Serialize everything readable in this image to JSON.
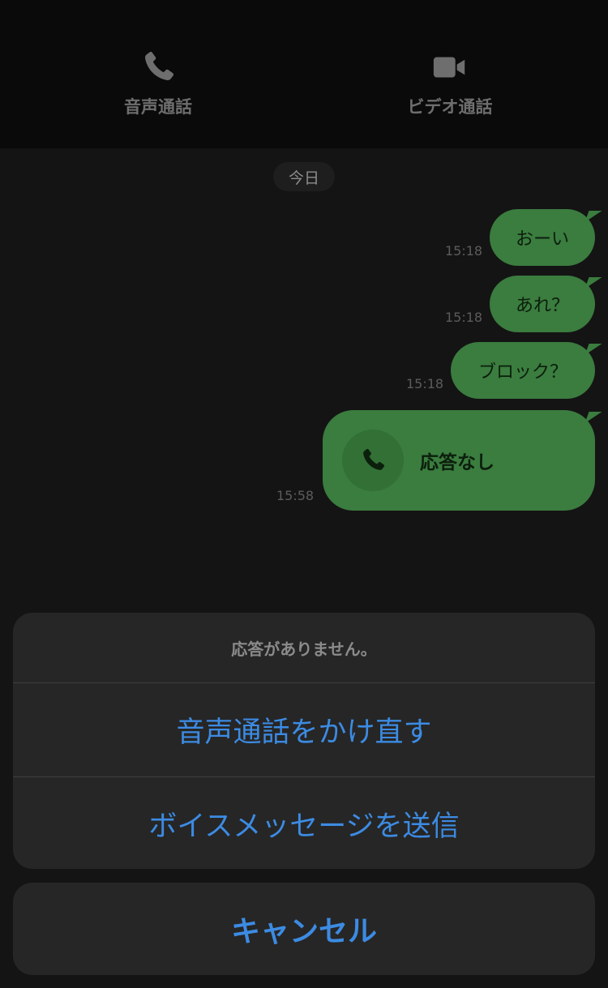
{
  "header": {
    "voice_call_label": "音声通話",
    "video_call_label": "ビデオ通話"
  },
  "chat": {
    "date_label": "今日",
    "messages": [
      {
        "text": "おーい",
        "time": "15:18"
      },
      {
        "text": "あれ？",
        "time": "15:18"
      },
      {
        "text": "ブロック？",
        "time": "15:18"
      },
      {
        "text": "応答なし",
        "time": "15:58"
      }
    ]
  },
  "sheet": {
    "title": "応答がありません。",
    "actions": [
      {
        "label": "音声通話をかけ直す"
      },
      {
        "label": "ボイスメッセージを送信"
      }
    ],
    "cancel_label": "キャンセル"
  },
  "colors": {
    "bubble": "#3b7c3f",
    "accent_blue": "#3c8be3",
    "sheet_bg": "#262626"
  }
}
